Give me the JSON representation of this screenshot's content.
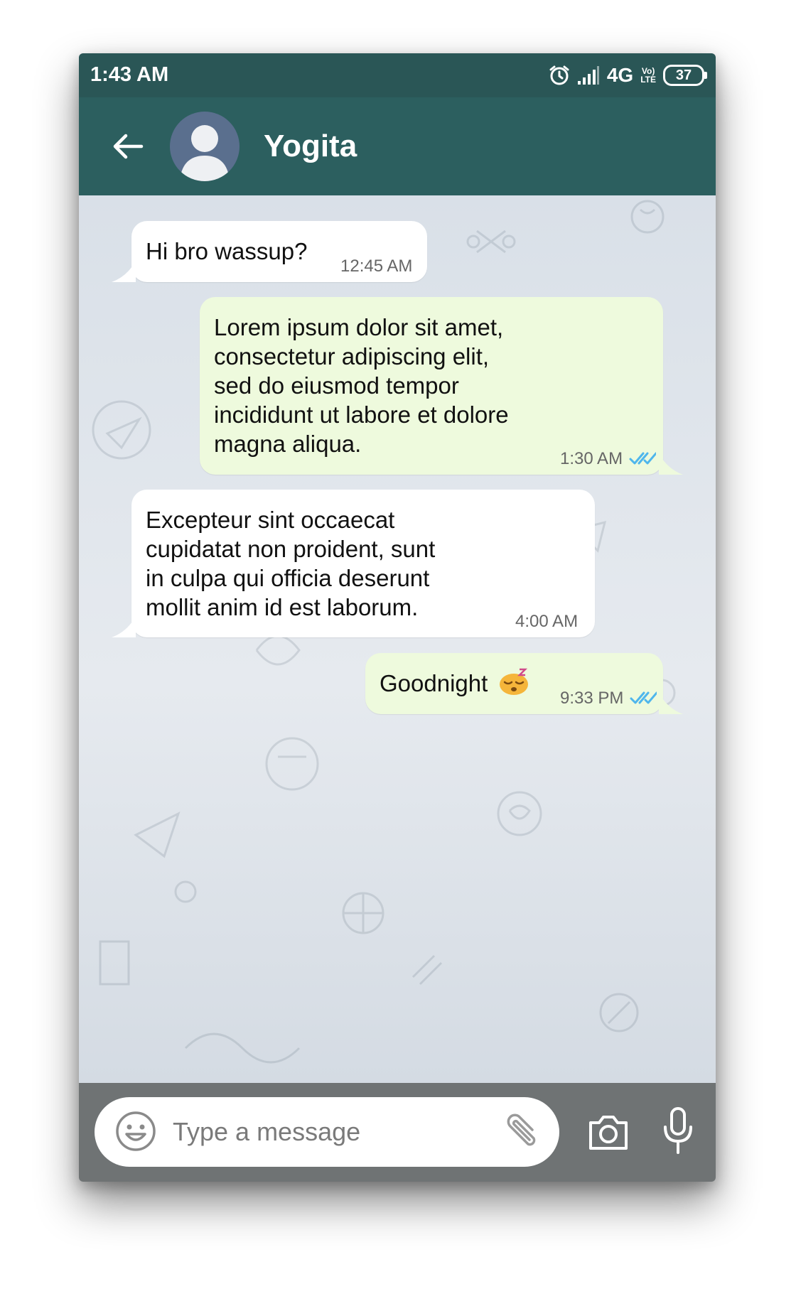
{
  "status_bar": {
    "time": "1:43 AM",
    "network": "4G",
    "volte_top": "Vo)",
    "volte_bottom": "LTE",
    "battery": "37"
  },
  "header": {
    "contact_name": "Yogita",
    "colors": {
      "header_bg": "#2c5f5f",
      "status_bg": "#2a5656"
    }
  },
  "messages": [
    {
      "direction": "incoming",
      "text": "Hi bro wassup?",
      "time": "12:45 AM"
    },
    {
      "direction": "outgoing",
      "text": "Lorem ipsum dolor sit amet,\nconsectetur adipiscing elit,\nsed do eiusmod tempor\nincididunt ut labore et dolore\nmagna aliqua.",
      "time": "1:30 AM",
      "status": "read"
    },
    {
      "direction": "incoming",
      "text": "Excepteur sint occaecat\ncupidatat non proident, sunt\nin culpa qui officia deserunt\nmollit anim id est laborum.",
      "time": "4:00 AM"
    },
    {
      "direction": "outgoing",
      "text": "Goodnight",
      "emoji": "sleeping-face",
      "time": "9:33 PM",
      "status": "read"
    }
  ],
  "composer": {
    "placeholder": "Type a message",
    "value": "",
    "icons": [
      "smiley-icon",
      "paperclip-icon",
      "camera-icon",
      "microphone-icon"
    ]
  },
  "colors": {
    "incoming_bubble": "#ffffff",
    "outgoing_bubble": "#eefadd",
    "read_ticks": "#4fb6ec"
  }
}
